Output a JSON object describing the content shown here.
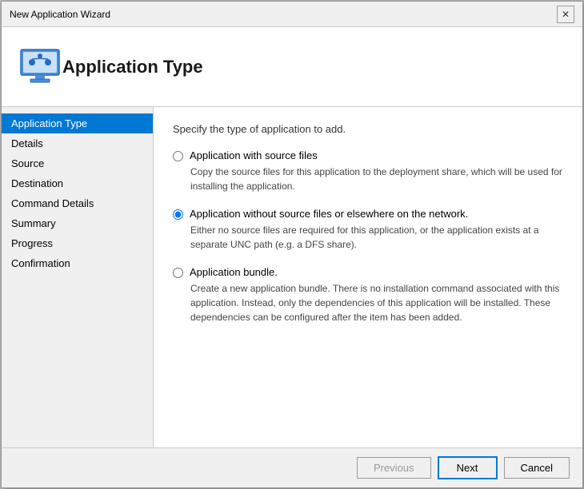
{
  "titleBar": {
    "title": "New Application Wizard",
    "closeLabel": "✕"
  },
  "header": {
    "title": "Application Type"
  },
  "sidebar": {
    "items": [
      {
        "id": "application-type",
        "label": "Application Type",
        "active": true
      },
      {
        "id": "details",
        "label": "Details",
        "active": false
      },
      {
        "id": "source",
        "label": "Source",
        "active": false
      },
      {
        "id": "destination",
        "label": "Destination",
        "active": false
      },
      {
        "id": "command-details",
        "label": "Command Details",
        "active": false
      },
      {
        "id": "summary",
        "label": "Summary",
        "active": false
      },
      {
        "id": "progress",
        "label": "Progress",
        "active": false
      },
      {
        "id": "confirmation",
        "label": "Confirmation",
        "active": false
      }
    ]
  },
  "content": {
    "instruction": "Specify the type of application to add.",
    "options": [
      {
        "id": "opt-source",
        "label": "Application with source files",
        "description": "Copy the source files for this application to the deployment share, which will be used for installing the application.",
        "checked": false
      },
      {
        "id": "opt-nosource",
        "label": "Application without source files or elsewhere on the network.",
        "description": "Either no source files are required for this application, or the application exists at a separate UNC path (e.g. a DFS share).",
        "checked": true
      },
      {
        "id": "opt-bundle",
        "label": "Application bundle.",
        "description": "Create a new application bundle.  There is no installation command associated with this application.  Instead, only the dependencies of this application will be installed.  These dependencies can be configured after the item has been added.",
        "checked": false
      }
    ]
  },
  "footer": {
    "previousLabel": "Previous",
    "nextLabel": "Next",
    "cancelLabel": "Cancel"
  }
}
